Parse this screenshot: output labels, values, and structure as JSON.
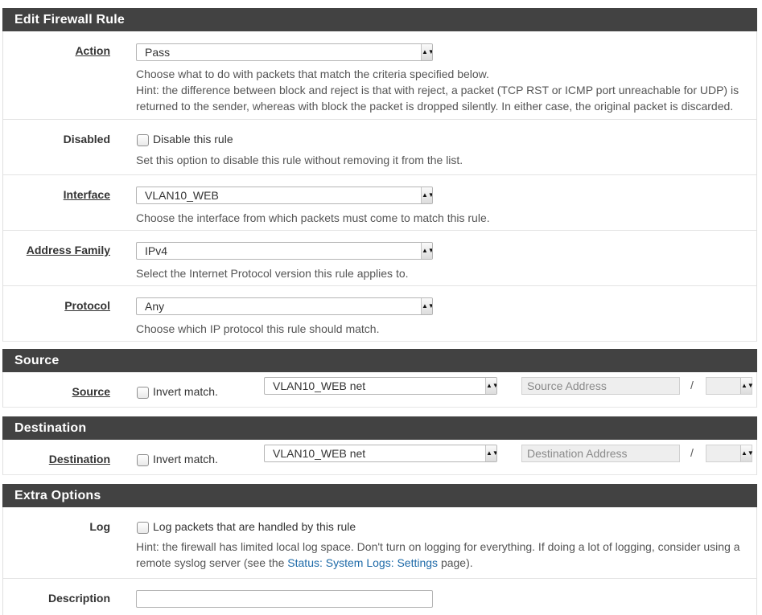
{
  "sections": {
    "edit_rule": "Edit Firewall Rule",
    "source": "Source",
    "destination": "Destination",
    "extra": "Extra Options"
  },
  "action": {
    "label": "Action",
    "value": "Pass",
    "help1": "Choose what to do with packets that match the criteria specified below.",
    "help2": "Hint: the difference between block and reject is that with reject, a packet (TCP RST or ICMP port unreachable for UDP) is returned to the sender, whereas with block the packet is dropped silently. In either case, the original packet is discarded."
  },
  "disabled": {
    "label": "Disabled",
    "checkbox_label": "Disable this rule",
    "help": "Set this option to disable this rule without removing it from the list."
  },
  "interface": {
    "label": "Interface",
    "value": "VLAN10_WEB",
    "help": "Choose the interface from which packets must come to match this rule."
  },
  "address_family": {
    "label": "Address Family",
    "value": "IPv4",
    "help": "Select the Internet Protocol version this rule applies to."
  },
  "protocol": {
    "label": "Protocol",
    "value": "Any",
    "help": "Choose which IP protocol this rule should match."
  },
  "source": {
    "label": "Source",
    "invert_label": "Invert match.",
    "type_value": "VLAN10_WEB net",
    "address_placeholder": "Source Address",
    "slash": "/"
  },
  "destination": {
    "label": "Destination",
    "invert_label": "Invert match.",
    "type_value": "VLAN10_WEB net",
    "address_placeholder": "Destination Address",
    "slash": "/"
  },
  "log": {
    "label": "Log",
    "checkbox_label": "Log packets that are handled by this rule",
    "help_prefix": "Hint: the firewall has limited local log space. Don't turn on logging for everything. If doing a lot of logging, consider using a remote syslog server (see the ",
    "help_link": "Status: System Logs: Settings",
    "help_suffix": " page)."
  },
  "description": {
    "label": "Description",
    "value": ""
  },
  "icons": {
    "select_arrow": "updown-arrow-icon",
    "checkbox": "checkbox-icon"
  }
}
